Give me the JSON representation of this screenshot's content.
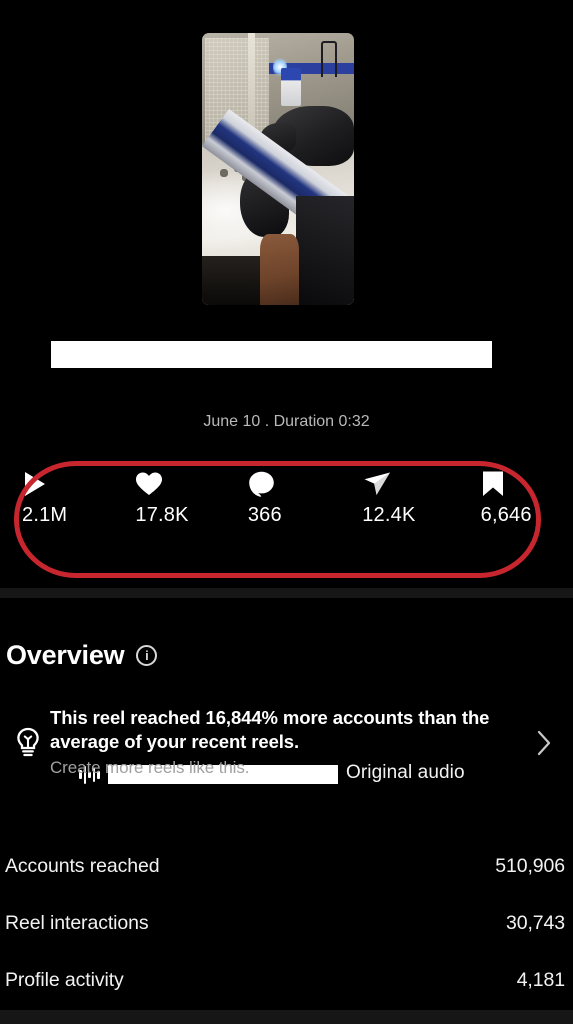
{
  "post": {
    "thumbnail_alt": "reel-thumbnail",
    "caption_redacted": "",
    "audio": {
      "name_redacted": "",
      "label": "Original audio",
      "icon": "audio-waveform-icon"
    },
    "meta": "June 10 . Duration 0:32"
  },
  "metrics": [
    {
      "icon": "play-icon",
      "name": "plays",
      "value": "2.1M"
    },
    {
      "icon": "heart-icon",
      "name": "likes",
      "value": "17.8K"
    },
    {
      "icon": "comment-icon",
      "name": "comments",
      "value": "366"
    },
    {
      "icon": "share-icon",
      "name": "shares",
      "value": "12.4K"
    },
    {
      "icon": "bookmark-icon",
      "name": "saves",
      "value": "6,646"
    }
  ],
  "annotation": {
    "shape": "oval-highlight",
    "color": "#c8262e"
  },
  "overview": {
    "title": "Overview",
    "info_icon": "info-icon",
    "insight": {
      "icon": "lightbulb-icon",
      "main": "This reel reached 16,844% more accounts than the average of your recent reels.",
      "sub": "Create more reels like this.",
      "chevron": "chevron-right-icon"
    },
    "stats": [
      {
        "label": "Accounts reached",
        "value": "510,906"
      },
      {
        "label": "Reel interactions",
        "value": "30,743"
      },
      {
        "label": "Profile activity",
        "value": "4,181"
      }
    ]
  }
}
